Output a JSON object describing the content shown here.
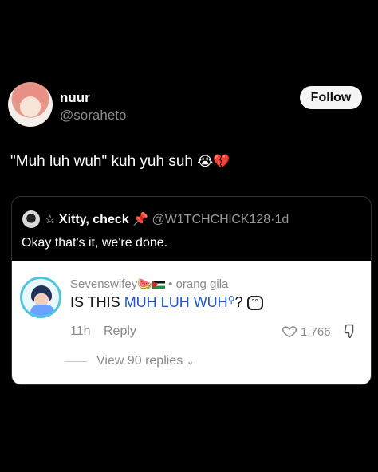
{
  "post": {
    "display_name": "nuur",
    "handle": "@soraheto",
    "follow_label": "Follow",
    "text": "\"Muh luh wuh\" kuh yuh suh",
    "emojis": [
      "😭",
      "💔"
    ]
  },
  "quote": {
    "name": "Xitty, check",
    "handle": "@W1TCHCHlCK128",
    "time": "1d",
    "text": "Okay that's it, we're done."
  },
  "comment": {
    "username": "Sevenswifey",
    "username_suffix": "🍉",
    "tag": "orang gila",
    "text_before": "IS THIS ",
    "text_link": "MUH LUH WUH",
    "text_after": "?",
    "time": "11h",
    "reply_label": "Reply",
    "likes": "1,766",
    "view_replies": "View 90 replies"
  },
  "colors": {
    "background": "#000000",
    "link": "#1f57d1",
    "muted": "#8a8a8a"
  },
  "icons": [
    "avatar",
    "star-icon",
    "pin-icon",
    "heart-icon",
    "dislike-icon",
    "magnifier-icon",
    "sticker-icon",
    "chevron-down-icon"
  ]
}
